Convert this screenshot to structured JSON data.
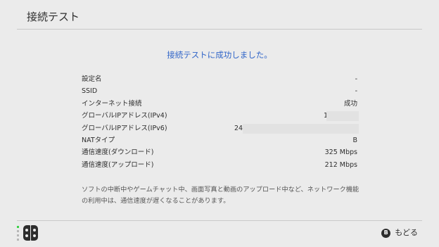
{
  "header": {
    "title": "接続テスト"
  },
  "result": {
    "message": "接続テストに成功しました。"
  },
  "rows": [
    {
      "label": "設定名",
      "value": "-"
    },
    {
      "label": "SSID",
      "value": "-"
    },
    {
      "label": "インターネット接続",
      "value": "成功"
    },
    {
      "label": "グローバルIPアドレス(IPv4)",
      "value": "1"
    },
    {
      "label": "グローバルIPアドレス(IPv6)",
      "value": "24"
    },
    {
      "label": "NATタイプ",
      "value": "B"
    },
    {
      "label": "通信速度(ダウンロード)",
      "value": "325 Mbps"
    },
    {
      "label": "通信速度(アップロード)",
      "value": "212 Mbps"
    }
  ],
  "note": "ソフトの中断中やゲームチャット中、画面写真と動画のアップロード中など、ネットワーク機能の利用中は、通信速度が遅くなることがあります。",
  "footer": {
    "back_label": "もどる",
    "back_button_glyph": "B"
  },
  "colors": {
    "background": "#ebebeb",
    "accent_blue": "#2f64c8",
    "text": "#2d2d2d",
    "divider": "#c9c9c9",
    "status_dot": "#3ed14a"
  }
}
